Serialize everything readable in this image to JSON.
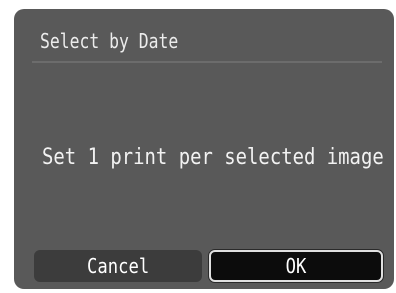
{
  "dialog": {
    "title": "Select by Date",
    "message": "Set 1 print per selected image"
  },
  "buttons": {
    "cancel_label": "Cancel",
    "ok_label": "OK",
    "selected": "OK"
  },
  "colors": {
    "screen_background": "#595959",
    "text": "#f2f2f2",
    "selected_button": "#0c0c0c",
    "unselected_button": "#3c3c3c",
    "selection_border": "#e0e0e0"
  }
}
